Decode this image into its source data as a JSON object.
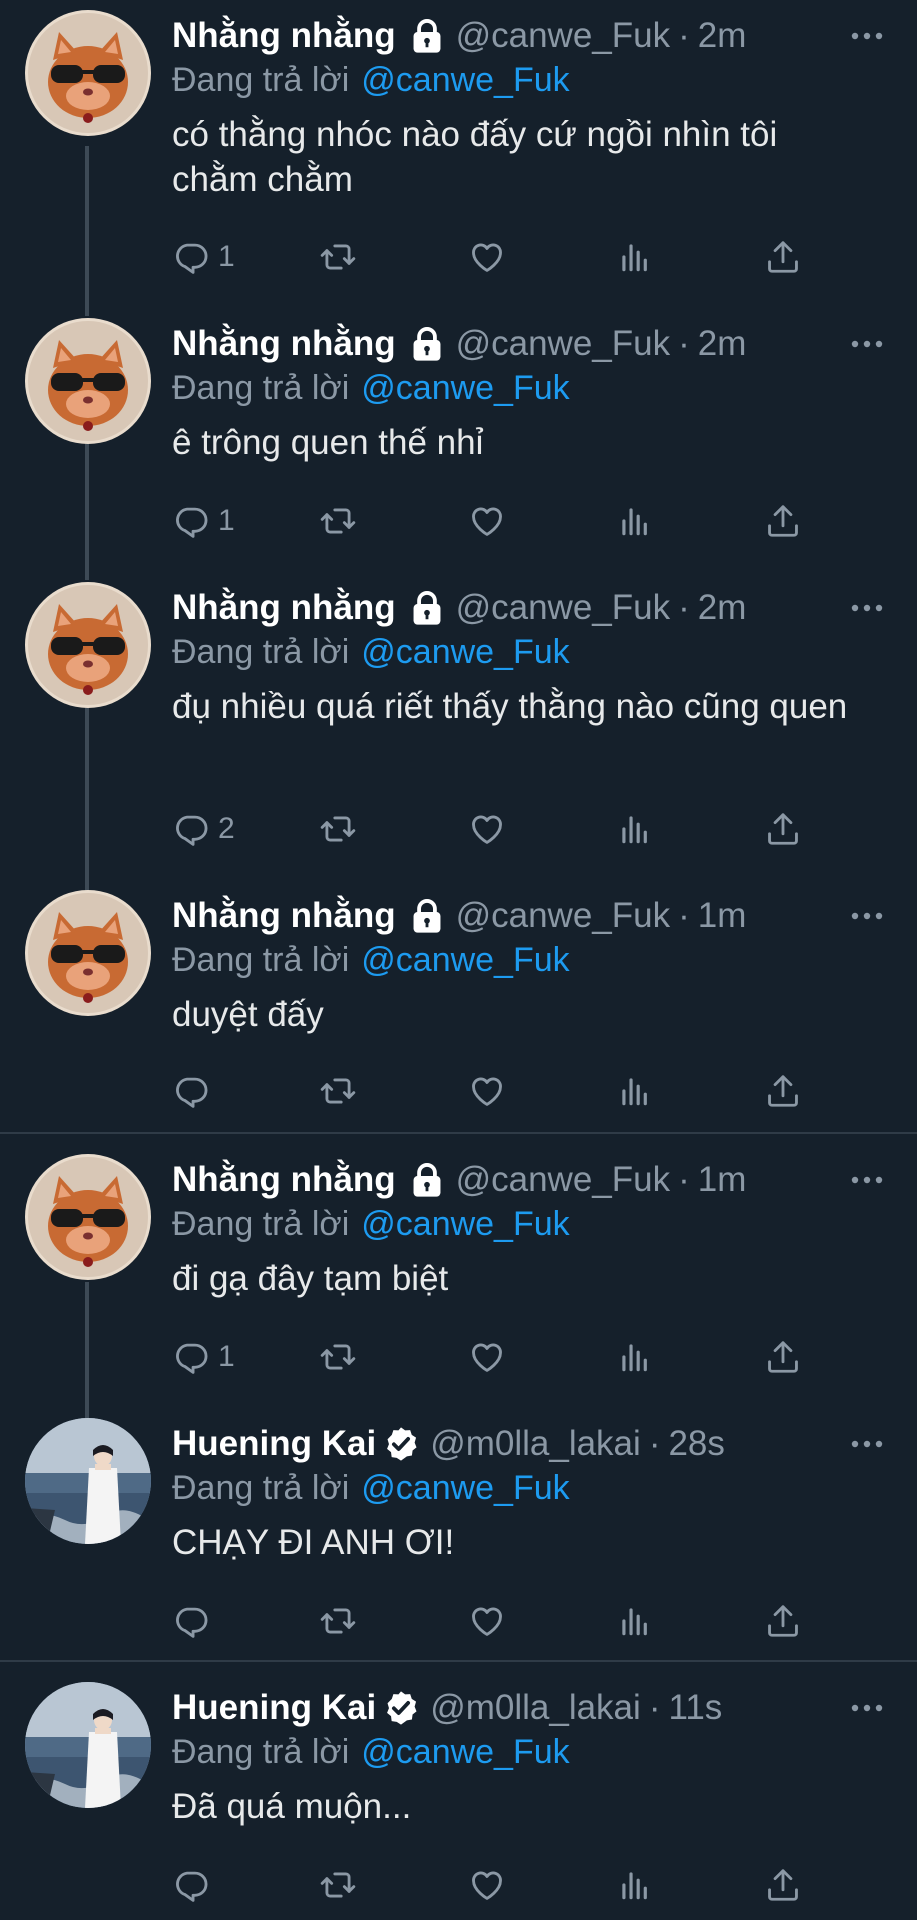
{
  "reply_label": "Đang trả lời",
  "reply_mention": "@canwe_Fuk",
  "tweets": [
    {
      "name": "Nhằng nhằng",
      "handle": "@canwe_Fuk",
      "time": "2m",
      "badge": "lock-icon",
      "text": "có thằng nhóc nào đấy cứ ngồi nhìn tôi chằm chằm",
      "replies": "1"
    },
    {
      "name": "Nhằng nhằng",
      "handle": "@canwe_Fuk",
      "time": "2m",
      "badge": "lock-icon",
      "text": "ê trông quen thế nhỉ",
      "replies": "1"
    },
    {
      "name": "Nhằng nhằng",
      "handle": "@canwe_Fuk",
      "time": "2m",
      "badge": "lock-icon",
      "text": "đụ nhiều quá riết thấy thằng nào cũng quen",
      "replies": "2"
    },
    {
      "name": "Nhằng nhằng",
      "handle": "@canwe_Fuk",
      "time": "1m",
      "badge": "lock-icon",
      "text": "duyệt đấy",
      "replies": ""
    },
    {
      "name": "Nhằng nhằng",
      "handle": "@canwe_Fuk",
      "time": "1m",
      "badge": "lock-icon",
      "text": "đi gạ đây tạm biệt",
      "replies": "1"
    },
    {
      "name": "Huening Kai",
      "handle": "@m0lla_lakai",
      "time": "28s",
      "badge": "verified-icon",
      "text": "CHẠY ĐI ANH ƠI!",
      "replies": ""
    },
    {
      "name": "Huening Kai",
      "handle": "@m0lla_lakai",
      "time": "11s",
      "badge": "verified-icon",
      "text": "Đã quá muộn...",
      "replies": ""
    }
  ],
  "colors": {
    "background": "#15202b",
    "text": "#e7e9ea",
    "secondary": "#8b98a5",
    "mention": "#1d9bf0",
    "thread_line": "#3d4a56",
    "divider": "#2f3b47"
  }
}
